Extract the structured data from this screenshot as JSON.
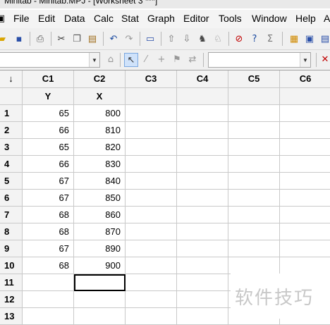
{
  "window": {
    "title": "Minitab - Minitab.MPJ - [Worksheet 3 ***]"
  },
  "menu": [
    "File",
    "Edit",
    "Data",
    "Calc",
    "Stat",
    "Graph",
    "Editor",
    "Tools",
    "Window",
    "Help",
    "A"
  ],
  "worksheet": {
    "corner": "↓",
    "columns": [
      "C1",
      "C2",
      "C3",
      "C4",
      "C5",
      "C6"
    ],
    "names": [
      "Y",
      "X",
      "",
      "",
      "",
      ""
    ],
    "rows": [
      {
        "n": "1",
        "c1": "65",
        "c2": "800"
      },
      {
        "n": "2",
        "c1": "66",
        "c2": "810"
      },
      {
        "n": "3",
        "c1": "65",
        "c2": "820"
      },
      {
        "n": "4",
        "c1": "66",
        "c2": "830"
      },
      {
        "n": "5",
        "c1": "67",
        "c2": "840"
      },
      {
        "n": "6",
        "c1": "67",
        "c2": "850"
      },
      {
        "n": "7",
        "c1": "68",
        "c2": "860"
      },
      {
        "n": "8",
        "c1": "68",
        "c2": "870"
      },
      {
        "n": "9",
        "c1": "67",
        "c2": "890"
      },
      {
        "n": "10",
        "c1": "68",
        "c2": "900"
      },
      {
        "n": "11",
        "c1": "",
        "c2": ""
      },
      {
        "n": "12",
        "c1": "",
        "c2": ""
      },
      {
        "n": "13",
        "c1": "",
        "c2": ""
      }
    ]
  },
  "watermark": "软件技巧"
}
